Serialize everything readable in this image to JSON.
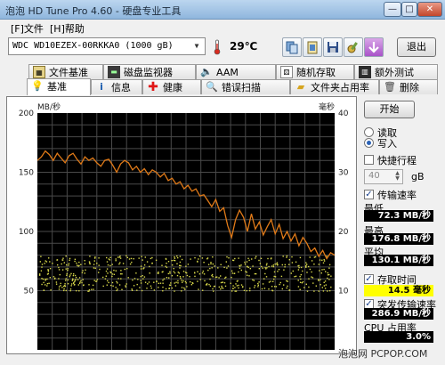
{
  "window": {
    "title": "泡泡 HD Tune Pro 4.60 - 硬盘专业工具",
    "min": "—",
    "max": "□",
    "close": "✕"
  },
  "menu": {
    "file": "[F]文件",
    "help": "[H]帮助"
  },
  "toolbar": {
    "drive": "WDC WD10EZEX-00RKKA0 (1000 gB)",
    "temperature": "29℃",
    "exit": "退出",
    "buttons": [
      "copy-info",
      "copy-screen",
      "save",
      "options",
      "down"
    ]
  },
  "tabs_top": [
    {
      "label": "文件基准",
      "icon": "folder-chart-icon"
    },
    {
      "label": "磁盘监视器",
      "icon": "monitor-icon"
    },
    {
      "label": "AAM",
      "icon": "speaker-icon"
    },
    {
      "label": "随机存取",
      "icon": "dice-icon"
    },
    {
      "label": "额外测试",
      "icon": "extra-icon"
    }
  ],
  "tabs_bottom": [
    {
      "label": "基准",
      "icon": "bulb-icon",
      "active": true
    },
    {
      "label": "信息",
      "icon": "info-icon"
    },
    {
      "label": "健康",
      "icon": "health-cross-icon"
    },
    {
      "label": "错误扫描",
      "icon": "magnifier-icon"
    },
    {
      "label": "文件夹占用率",
      "icon": "folder-icon"
    },
    {
      "label": "删除",
      "icon": "trash-icon"
    }
  ],
  "controls": {
    "start": "开始",
    "read": "读取",
    "write": "写入",
    "mode": "write",
    "quick_test": "快捷行程",
    "quick_size": "40",
    "quick_unit": "gB",
    "transfer_rate": "传输速率",
    "min_label": "最低",
    "min_value": "72.3 MB/秒",
    "max_label": "最高",
    "max_value": "176.8 MB/秒",
    "avg_label": "平均",
    "avg_value": "130.1 MB/秒",
    "access_time": "存取时间",
    "access_value": "14.5 毫秒",
    "burst_rate": "突发传输速率",
    "burst_value": "286.9 MB/秒",
    "cpu_label": "CPU 占用率",
    "cpu_value": "3.0%"
  },
  "watermark": "泡泡网 PCPOP.COM",
  "chart_data": {
    "type": "line",
    "y_left_label": "MB/秒",
    "y_right_label": "毫秒",
    "y_left_ticks": [
      200,
      150,
      100,
      50
    ],
    "y_right_ticks": [
      40,
      30,
      20,
      10
    ],
    "ylim_left": [
      0,
      200
    ],
    "ylim_right": [
      0,
      40
    ],
    "grid": true,
    "series": [
      {
        "name": "传输速率",
        "color": "#e07a18",
        "values": [
          160,
          163,
          168,
          165,
          160,
          166,
          162,
          158,
          164,
          166,
          161,
          157,
          163,
          160,
          162,
          158,
          155,
          160,
          161,
          156,
          150,
          157,
          160,
          158,
          152,
          155,
          150,
          153,
          148,
          152,
          150,
          146,
          149,
          143,
          145,
          140,
          142,
          136,
          139,
          134,
          136,
          130,
          131,
          126,
          121,
          127,
          117,
          120,
          105,
          95,
          110,
          118,
          112,
          100,
          115,
          102,
          108,
          97,
          104,
          110,
          98,
          106,
          94,
          100,
          92,
          98,
          88,
          95,
          90,
          83,
          86,
          79,
          84,
          77,
          82,
          80
        ]
      },
      {
        "name": "存取时间",
        "color": "#d8d84a",
        "type": "scatter",
        "approx_range": [
          10,
          16
        ]
      }
    ]
  }
}
